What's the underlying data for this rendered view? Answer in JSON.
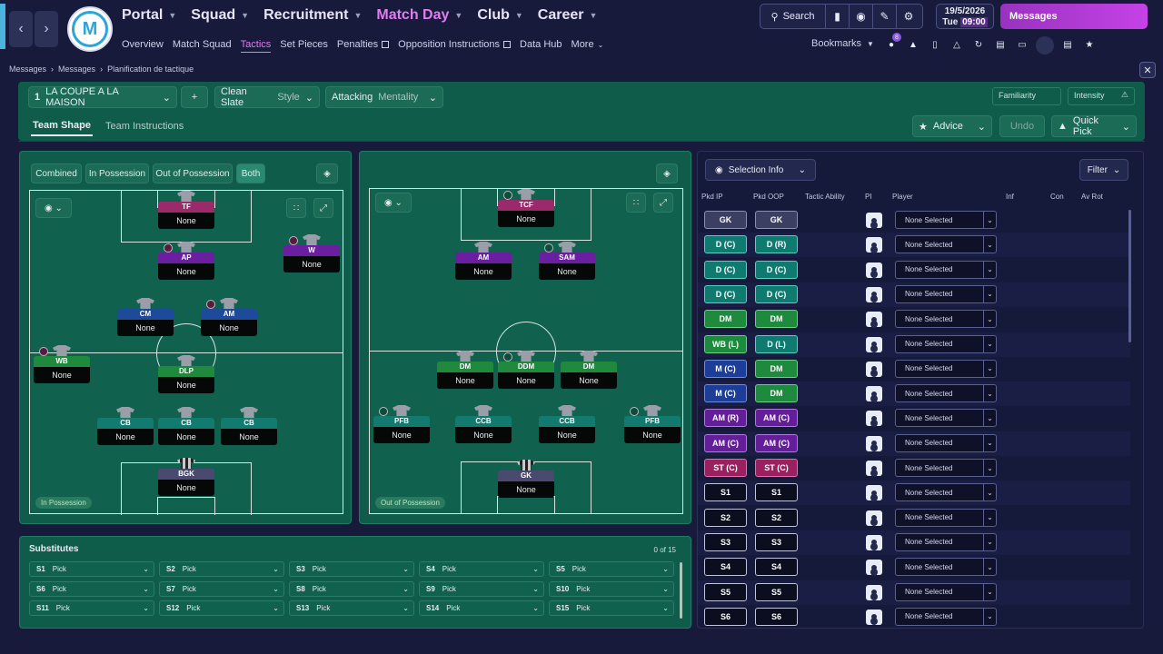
{
  "header": {
    "nav": [
      "Portal",
      "Squad",
      "Recruitment",
      "Match Day",
      "Club",
      "Career"
    ],
    "active_nav": "Match Day",
    "subnav": [
      "Overview",
      "Match Squad",
      "Tactics",
      "Set Pieces",
      "Penalties",
      "Opposition Instructions",
      "Data Hub",
      "More"
    ],
    "search_label": "Search",
    "date": "19/5/2026",
    "day": "Tue",
    "time": "09:00",
    "messages_label": "Messages",
    "bookmarks_label": "Bookmarks",
    "notif_count": "8"
  },
  "breadcrumb": [
    "Messages",
    "Messages",
    "Planification de tactique"
  ],
  "tactic": {
    "number": "1",
    "name": "LA COUPE A LA MAISON",
    "add": "+",
    "style": "Clean Slate",
    "style_label": "Style",
    "mentality": "Attacking",
    "mentality_label": "Mentality",
    "familiarity_label": "Familiarity",
    "intensity_label": "Intensity",
    "tabs": [
      "Team Shape",
      "Team Instructions"
    ],
    "advice_label": "Advice",
    "undo_label": "Undo",
    "quickpick_label": "Quick Pick"
  },
  "phase_tabs": [
    "Combined",
    "In Possession",
    "Out of Possession",
    "Both"
  ],
  "in_possession_label": "In Possession",
  "out_possession_label": "Out of Possession",
  "ip_players": [
    {
      "role": "TF",
      "name": "None",
      "color": "pink"
    },
    {
      "role": "AP",
      "name": "None",
      "color": "purp"
    },
    {
      "role": "W",
      "name": "None",
      "color": "purp"
    },
    {
      "role": "CM",
      "name": "None",
      "color": "blue"
    },
    {
      "role": "AM",
      "name": "None",
      "color": "blue"
    },
    {
      "role": "WB",
      "name": "None",
      "color": "green"
    },
    {
      "role": "DLP",
      "name": "None",
      "color": "green"
    },
    {
      "role": "CB",
      "name": "None",
      "color": "teal"
    },
    {
      "role": "CB",
      "name": "None",
      "color": "teal"
    },
    {
      "role": "CB",
      "name": "None",
      "color": "teal"
    },
    {
      "role": "BGK",
      "name": "None",
      "color": "gk"
    }
  ],
  "oop_players": [
    {
      "role": "TCF",
      "name": "None",
      "color": "pink"
    },
    {
      "role": "AM",
      "name": "None",
      "color": "purp"
    },
    {
      "role": "SAM",
      "name": "None",
      "color": "purp"
    },
    {
      "role": "DM",
      "name": "None",
      "color": "green"
    },
    {
      "role": "DDM",
      "name": "None",
      "color": "green"
    },
    {
      "role": "DM",
      "name": "None",
      "color": "green"
    },
    {
      "role": "PFB",
      "name": "None",
      "color": "teal"
    },
    {
      "role": "CCB",
      "name": "None",
      "color": "teal"
    },
    {
      "role": "CCB",
      "name": "None",
      "color": "teal"
    },
    {
      "role": "PFB",
      "name": "None",
      "color": "teal"
    },
    {
      "role": "GK",
      "name": "None",
      "color": "gk"
    }
  ],
  "selection": {
    "info_label": "Selection Info",
    "filter_label": "Filter",
    "headers": [
      "Pkd IP",
      "Pkd OOP",
      "Tactic Ability",
      "PI",
      "Player",
      "Inf",
      "Con",
      "Av Rot"
    ],
    "rows": [
      {
        "ip": "GK",
        "oop": "GK",
        "ipc": "gk",
        "oopc": "gk",
        "player": "None Selected"
      },
      {
        "ip": "D (C)",
        "oop": "D (R)",
        "ipc": "d",
        "oopc": "d",
        "player": "None Selected"
      },
      {
        "ip": "D (C)",
        "oop": "D (C)",
        "ipc": "d",
        "oopc": "d",
        "player": "None Selected"
      },
      {
        "ip": "D (C)",
        "oop": "D (C)",
        "ipc": "d",
        "oopc": "d",
        "player": "None Selected"
      },
      {
        "ip": "DM",
        "oop": "DM",
        "ipc": "dm",
        "oopc": "dm",
        "player": "None Selected"
      },
      {
        "ip": "WB (L)",
        "oop": "D (L)",
        "ipc": "dm",
        "oopc": "d",
        "player": "None Selected"
      },
      {
        "ip": "M (C)",
        "oop": "DM",
        "ipc": "m",
        "oopc": "dm",
        "player": "None Selected"
      },
      {
        "ip": "M (C)",
        "oop": "DM",
        "ipc": "m",
        "oopc": "dm",
        "player": "None Selected"
      },
      {
        "ip": "AM (R)",
        "oop": "AM (C)",
        "ipc": "am",
        "oopc": "am",
        "player": "None Selected"
      },
      {
        "ip": "AM (C)",
        "oop": "AM (C)",
        "ipc": "am",
        "oopc": "am",
        "player": "None Selected"
      },
      {
        "ip": "ST (C)",
        "oop": "ST (C)",
        "ipc": "st",
        "oopc": "st",
        "player": "None Selected"
      },
      {
        "ip": "S1",
        "oop": "S1",
        "ipc": "s",
        "oopc": "s",
        "player": "None Selected"
      },
      {
        "ip": "S2",
        "oop": "S2",
        "ipc": "s",
        "oopc": "s",
        "player": "None Selected"
      },
      {
        "ip": "S3",
        "oop": "S3",
        "ipc": "s",
        "oopc": "s",
        "player": "None Selected"
      },
      {
        "ip": "S4",
        "oop": "S4",
        "ipc": "s",
        "oopc": "s",
        "player": "None Selected"
      },
      {
        "ip": "S5",
        "oop": "S5",
        "ipc": "s",
        "oopc": "s",
        "player": "None Selected"
      },
      {
        "ip": "S6",
        "oop": "S6",
        "ipc": "s",
        "oopc": "s",
        "player": "None Selected"
      }
    ]
  },
  "subs": {
    "title": "Substitutes",
    "count": "0 of 15",
    "slots": [
      {
        "id": "S1",
        "label": "Pick"
      },
      {
        "id": "S2",
        "label": "Pick"
      },
      {
        "id": "S3",
        "label": "Pick"
      },
      {
        "id": "S4",
        "label": "Pick"
      },
      {
        "id": "S5",
        "label": "Pick"
      },
      {
        "id": "S6",
        "label": "Pick"
      },
      {
        "id": "S7",
        "label": "Pick"
      },
      {
        "id": "S8",
        "label": "Pick"
      },
      {
        "id": "S9",
        "label": "Pick"
      },
      {
        "id": "S10",
        "label": "Pick"
      },
      {
        "id": "S11",
        "label": "Pick"
      },
      {
        "id": "S12",
        "label": "Pick"
      },
      {
        "id": "S13",
        "label": "Pick"
      },
      {
        "id": "S14",
        "label": "Pick"
      },
      {
        "id": "S15",
        "label": "Pick"
      }
    ]
  }
}
